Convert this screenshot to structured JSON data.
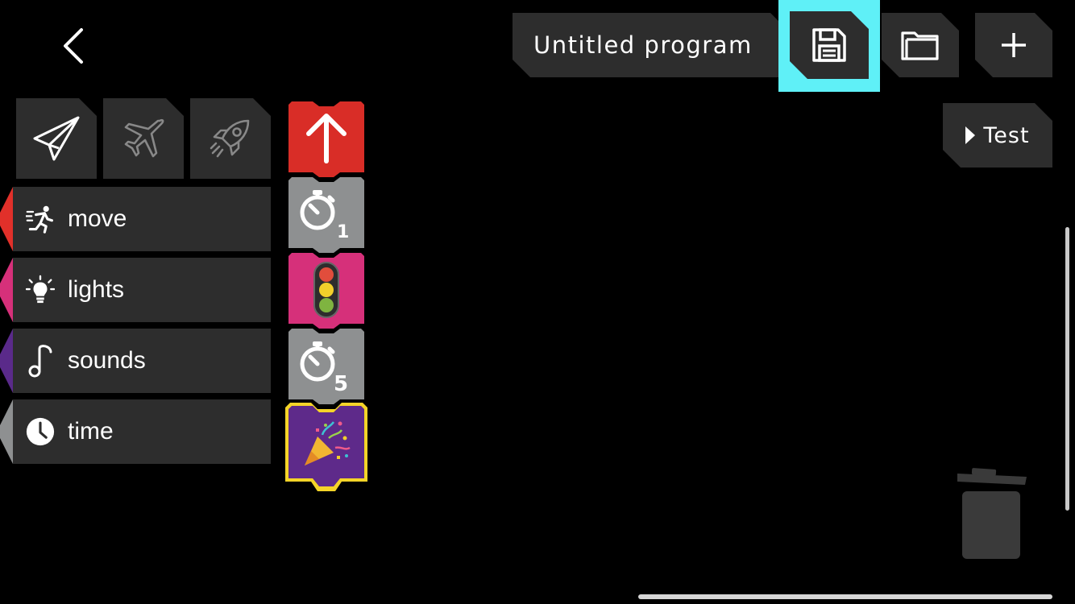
{
  "header": {
    "program_title": "Untitled program",
    "save_icon": "floppy-disk-icon",
    "open_icon": "folder-icon",
    "new_icon": "plus-icon",
    "back_icon": "chevron-left-icon",
    "highlight_color": "#5ff0f7"
  },
  "test_button": {
    "label": "Test",
    "icon": "play-icon"
  },
  "vehicles": [
    {
      "name": "paper-plane",
      "icon": "paper-plane-icon",
      "selected": true
    },
    {
      "name": "airplane",
      "icon": "airplane-icon",
      "selected": false
    },
    {
      "name": "rocket",
      "icon": "rocket-icon",
      "selected": false
    }
  ],
  "categories": [
    {
      "label": "move",
      "color": "#e1302a",
      "icon": "running-person-icon"
    },
    {
      "label": "lights",
      "color": "#d6307a",
      "icon": "lightbulb-icon"
    },
    {
      "label": "sounds",
      "color": "#5a2a8a",
      "icon": "music-note-icon"
    },
    {
      "label": "time",
      "color": "#8e9091",
      "icon": "clock-icon"
    }
  ],
  "program_blocks": [
    {
      "type": "move-forward",
      "color": "#d92d27",
      "icon": "up-arrow-icon"
    },
    {
      "type": "wait",
      "color": "#8e9091",
      "icon": "stopwatch-icon",
      "value": "1"
    },
    {
      "type": "lights",
      "color": "#d6307a",
      "icon": "traffic-light-icon"
    },
    {
      "type": "wait",
      "color": "#8e9091",
      "icon": "stopwatch-icon",
      "value": "5"
    },
    {
      "type": "celebrate",
      "color": "#5e2a8a",
      "icon": "party-popper-icon",
      "highlight": "#f5d428"
    }
  ],
  "trash_icon": "trash-can-icon"
}
